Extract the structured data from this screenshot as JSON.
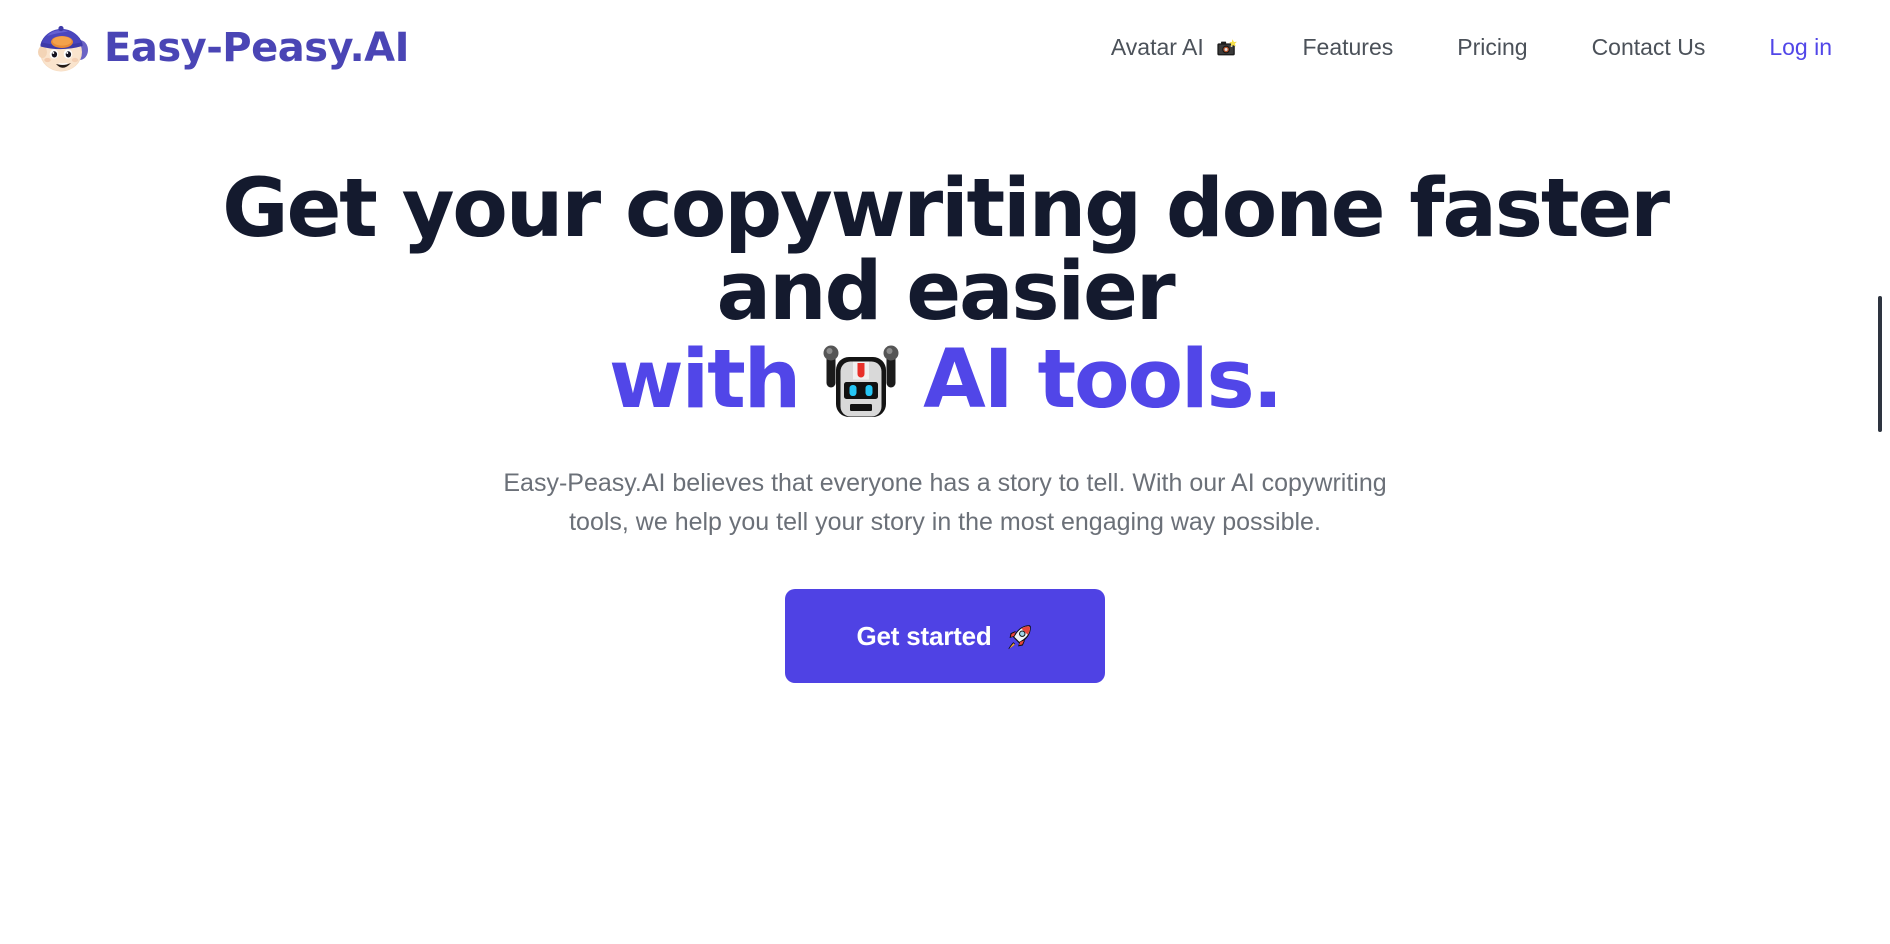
{
  "brand": {
    "name": "Easy-Peasy.AI",
    "logo_icon": "baby-face-with-cap-logo",
    "accent_color": "#4a45b5"
  },
  "nav": {
    "items": [
      {
        "label": "Avatar AI",
        "emoji": "camera-with-flash-icon",
        "emoji_char": "📸",
        "accent": false
      },
      {
        "label": "Features",
        "emoji": "",
        "emoji_char": "",
        "accent": false
      },
      {
        "label": "Pricing",
        "emoji": "",
        "emoji_char": "",
        "accent": false
      },
      {
        "label": "Contact Us",
        "emoji": "",
        "emoji_char": "",
        "accent": false
      },
      {
        "label": "Log in",
        "emoji": "",
        "emoji_char": "",
        "accent": true
      }
    ]
  },
  "hero": {
    "title_line": "Get your copywriting done faster and easier",
    "accent_prefix": "with",
    "accent_suffix": "AI tools.",
    "robot_icon": "robot-face-icon",
    "subtitle": "Easy-Peasy.AI believes that everyone has a story to tell. With our AI copywriting tools, we help you tell your story in the most engaging way possible.",
    "cta_label": "Get started",
    "cta_icon": "rocket-icon"
  },
  "colors": {
    "headline": "#141a2e",
    "accent": "#5146e8",
    "cta_background": "#4f42e4",
    "body_text": "#6b7078",
    "nav_text": "#4b5159",
    "page_background": "#ffffff",
    "scrollbar_thumb": "#2e3440"
  }
}
